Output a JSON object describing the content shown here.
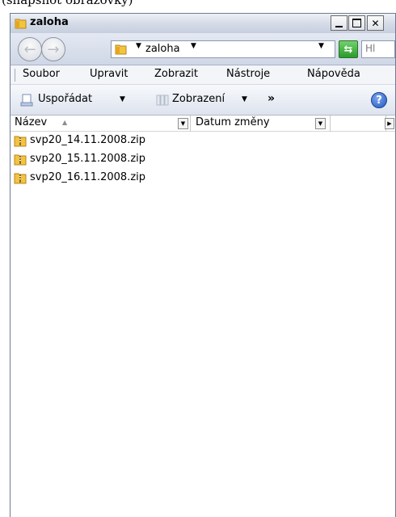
{
  "caption": "(snapshot obrazovky)",
  "window": {
    "title": "zaloha"
  },
  "address": {
    "path": "zaloha",
    "search_placeholder": "Hl"
  },
  "menu": [
    "Soubor",
    "Upravit",
    "Zobrazit",
    "Nástroje",
    "Nápověda"
  ],
  "toolbar": {
    "organize": "Uspořádat",
    "views": "Zobrazení",
    "more": "»",
    "help": "?"
  },
  "columns": {
    "name": "Název",
    "date": "Datum změny"
  },
  "files": [
    {
      "name": "svp20_14.11.2008.zip"
    },
    {
      "name": "svp20_15.11.2008.zip"
    },
    {
      "name": "svp20_16.11.2008.zip"
    }
  ],
  "colors": {
    "folder": "#f2c440",
    "zip": "#e8b83a",
    "help": "#2057c4",
    "refresh": "#2a9a2a"
  }
}
